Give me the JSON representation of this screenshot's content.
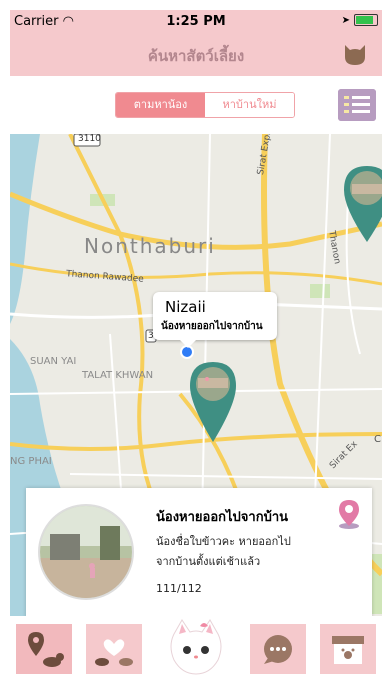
{
  "status": {
    "carrier": "Carrier",
    "time": "1:25 PM"
  },
  "navbar": {
    "title": "ค้นหาสัตว์เลี้ยง"
  },
  "segment": {
    "tabs": [
      "ตามหาน้อง",
      "หาบ้านใหม่"
    ],
    "selected": "ตามหาน้อง"
  },
  "map": {
    "labels": {
      "nonthaburi": "Nonthaburi",
      "rawadee": "Thanon Rawadee",
      "suan_yai": "SUAN YAI",
      "talat_khwan": "TALAT KHWAN",
      "ng_phai": "NG PHAI",
      "sirat_expressway": "Sirat Expressway",
      "sirat_ex": "Sirat Ex",
      "thanon": "Thanon",
      "route_3110": "3110",
      "route_3": "3",
      "c": "C"
    },
    "callout": {
      "name": "Nizaii",
      "subtitle": "น้องหายออกไปจากบ้าน"
    }
  },
  "card": {
    "headline": "น้องหายออกไปจากบ้าน",
    "desc_line1": "น้องชื่อใบข้าวคะ หายออกไป",
    "desc_line2": "จากบ้านตั้งแต่เช้าแล้ว",
    "count": "111/112"
  },
  "tabbar": {
    "items": [
      "map-pin-dog-tab",
      "pets-love-tab",
      "cat-home-tab",
      "chat-tab",
      "pet-shop-tab"
    ]
  },
  "colors": {
    "pink": "#f5c9cc",
    "accent": "#f08a90",
    "teal": "#3f8f83",
    "purple": "#b79cc0"
  }
}
